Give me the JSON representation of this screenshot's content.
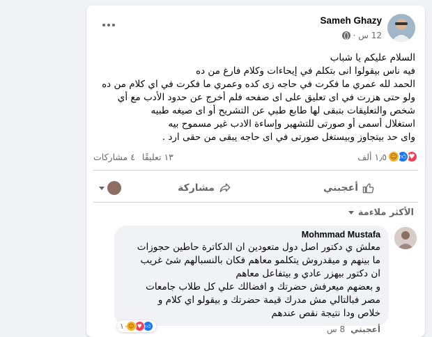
{
  "post": {
    "author": "Sameh Ghazy",
    "time": "12 س ·",
    "lines": [
      "السلام عليكم يا شباب",
      "فيه ناس بيقولوا انى بتكلم في إيحاءات وكلام فارغ من ده",
      "الحمد لله عمري ما فكرت في حاجه زى كده وعمري ما فكرت في اي كلام من ده",
      "ولو حتى هزرت في اى تعليق على اى صفحه فلم أخرج عن حدود الأدب مع أي",
      "شخص والتعليقات بتبقى لها طابع طبي عن التشريح أو اى صيغه طبيه",
      "استغلال أسمى أو صورتى للتشهير وإساءة الادب غير مسموح بيه",
      "واى حد بيتجاوز وبيستغل صورتى في اى حاجه  يبقى من حقى ارد ."
    ],
    "reactions_count": "١٫٥ ألف",
    "comments_count": "١٣ تعليقًا",
    "shares_count": "٤ مشاركات"
  },
  "actions": {
    "like": "أعجبني",
    "share": "مشاركة"
  },
  "sort": {
    "label": "الأكثر ملاءمة"
  },
  "comment": {
    "author": "Mohmmad Mustafa",
    "lines": [
      "معلش ي دكتور اصل دول متعودين ان الدكاترة حاطين حجوزات",
      "ما بينهم و ميقدروش يتكلمو معاهم فكان بالنسبالهم شئ غريب",
      "ان دكتور بيهزر عادي و بيتفاعل معاهم",
      "و بعضهم ميعرفش حضرتك و افضالك علي كل طلاب جامعات",
      "مصر فبالتالي مش مدرك قيمة حضرتك و بيقولو اي كلام و",
      "خلاص ودا نتيجة نقص عندهم"
    ],
    "reactions_count": "١٠",
    "like": "أعجبني",
    "time": "8 س"
  },
  "colors": {
    "like_blue": "#1877f2",
    "love_red": "#f33e58",
    "care_yellow": "#f7b125",
    "secondary_text": "#65676b"
  },
  "icons": [
    "globe-icon",
    "more-icon",
    "like-icon",
    "love-icon",
    "care-icon",
    "thumbs-up-icon",
    "share-arrow-icon",
    "chevron-down-icon"
  ]
}
